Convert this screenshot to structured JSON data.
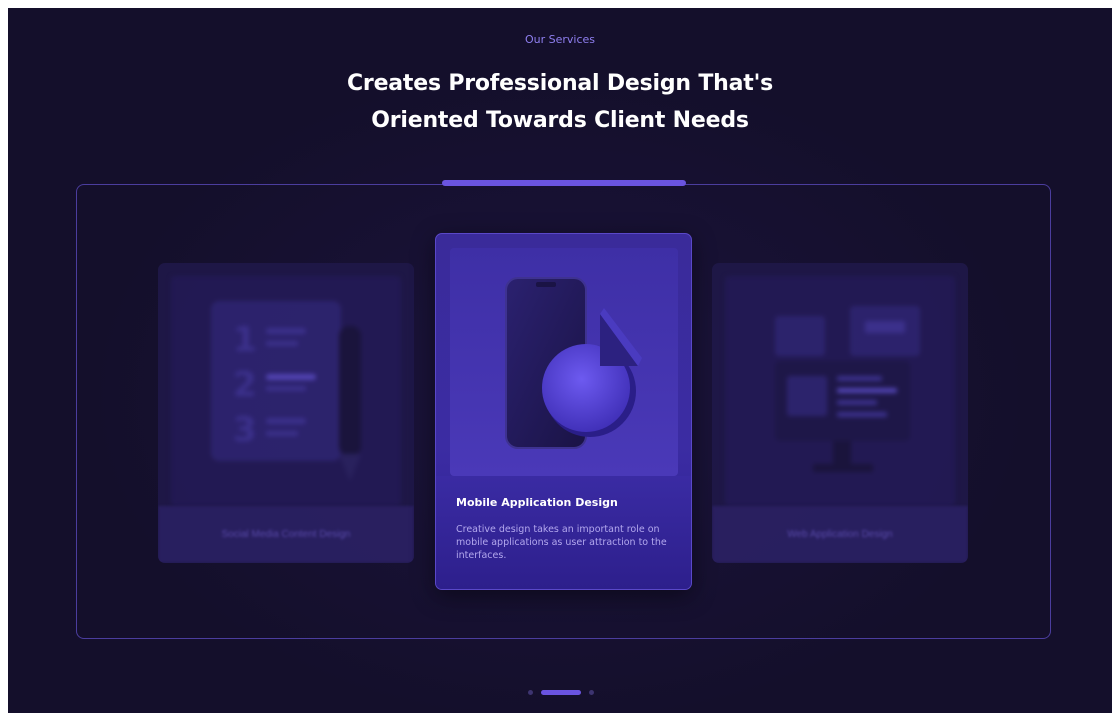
{
  "header": {
    "eyebrow": "Our Services",
    "title_line1": "Creates Professional Design That's",
    "title_line2": "Oriented Towards Client Needs"
  },
  "cards": [
    {
      "title": "Social Media Content Design",
      "icon": "numbered-list-pen-icon",
      "state": "inactive"
    },
    {
      "title": "Mobile Application Design",
      "description": "Creative design takes an important role on mobile applications as user attraction to the interfaces.",
      "icon": "phone-pie-chart-icon",
      "state": "active"
    },
    {
      "title": "Web Application Design",
      "icon": "monitor-dashboard-icon",
      "state": "inactive"
    }
  ],
  "pagination": {
    "count": 3,
    "active_index": 1
  },
  "colors": {
    "background": "#140f2b",
    "accent": "#6a54e0",
    "eyebrow": "#8f7ff0",
    "card_active": "#3b2ca3",
    "text_muted": "#b3a8ee"
  }
}
